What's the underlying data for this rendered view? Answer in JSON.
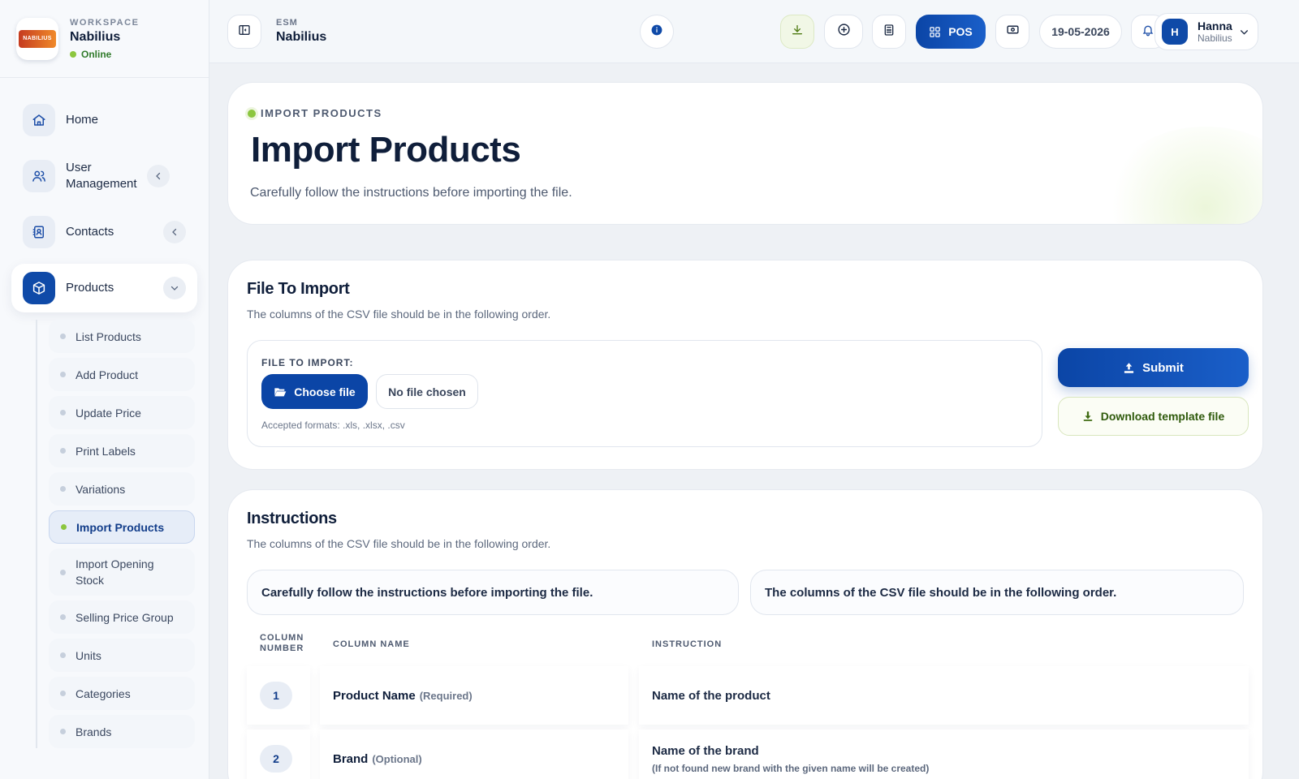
{
  "workspace": {
    "label": "WORKSPACE",
    "name": "Nabilius",
    "status": "Online",
    "logo_text": "NABILIUS"
  },
  "sidebar": {
    "items": [
      {
        "label": "Home"
      },
      {
        "label": "User Management"
      },
      {
        "label": "Contacts"
      },
      {
        "label": "Products"
      }
    ],
    "products_sub": [
      {
        "label": "List Products"
      },
      {
        "label": "Add Product"
      },
      {
        "label": "Update Price"
      },
      {
        "label": "Print Labels"
      },
      {
        "label": "Variations"
      },
      {
        "label": "Import Products"
      },
      {
        "label": "Import Opening Stock"
      },
      {
        "label": "Selling Price Group"
      },
      {
        "label": "Units"
      },
      {
        "label": "Categories"
      },
      {
        "label": "Brands"
      }
    ]
  },
  "topbar": {
    "esm_label": "ESM",
    "esm_name": "Nabilius",
    "pos_label": "POS",
    "date": "19-05-2026",
    "user": {
      "initial": "H",
      "name": "Hanna",
      "org": "Nabilius"
    }
  },
  "hero": {
    "eyebrow": "IMPORT PRODUCTS",
    "title": "Import Products",
    "subtitle": "Carefully follow the instructions before importing the file."
  },
  "file_section": {
    "title": "File To Import",
    "subtitle": "The columns of the CSV file should be in the following order.",
    "field_label": "FILE TO IMPORT:",
    "choose_label": "Choose file",
    "no_file_label": "No file chosen",
    "formats": "Accepted formats: .xls, .xlsx, .csv",
    "submit_label": "Submit",
    "template_label": "Download template file"
  },
  "instructions": {
    "title": "Instructions",
    "subtitle": "The columns of the CSV file should be in the following order.",
    "note_left": "Carefully follow the instructions before importing the file.",
    "note_right": "The columns of the CSV file should be in the following order.",
    "headers": {
      "number_line1": "COLUMN",
      "number_line2": "NUMBER",
      "name": "COLUMN NAME",
      "instruction": "INSTRUCTION"
    },
    "rows": [
      {
        "number": "1",
        "name": "Product Name",
        "tag": "(Required)",
        "instruction": "Name of the product",
        "note": ""
      },
      {
        "number": "2",
        "name": "Brand",
        "tag": "(Optional)",
        "instruction": "Name of the brand",
        "note": "(If not found new brand with the given name will be created)"
      }
    ]
  },
  "colors": {
    "primary": "#0b45a6",
    "accent_green": "#8cc63f",
    "text_dark": "#0f1e3a"
  }
}
